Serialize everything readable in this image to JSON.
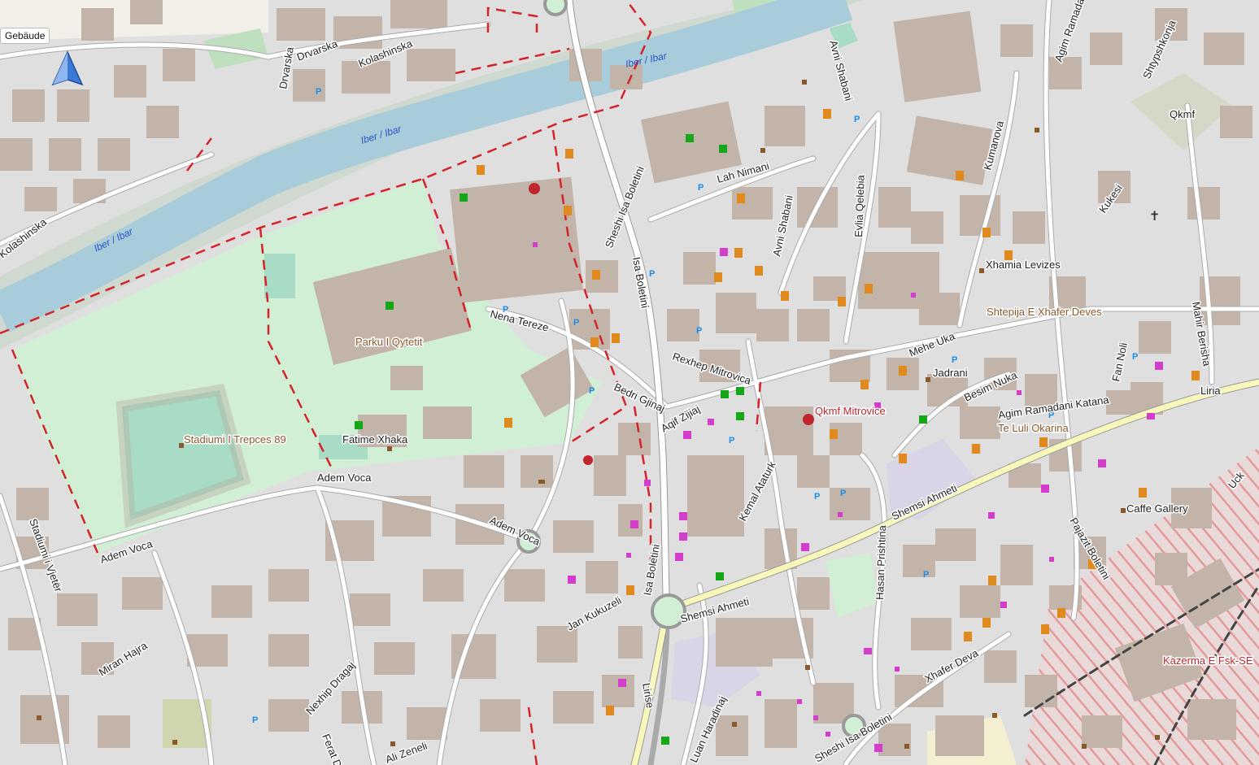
{
  "layer_label": "Gebäude",
  "colors": {
    "background": "#e0dfdf",
    "building": "#c3b4a9",
    "water": "#a9ccdb",
    "park": "#d1efd4",
    "pitch": "#a9dcc7",
    "road": "#ffffff",
    "primary_road": "#f8f8ba",
    "boundary": "#d4232a",
    "military": "#e49a9a"
  },
  "water_labels": [
    "Iber / Ibar",
    "Iber / Ibar",
    "Iber / Ibar"
  ],
  "street_labels": [
    "Kolashinska",
    "Drvarska",
    "Drvarska",
    "Kolashinska",
    "Nena Tereze",
    "Sheshi Isa Boletini",
    "Isa Boletini",
    "Lah Nimani",
    "Avni Shabani",
    "Avni Shabani",
    "Evlia Qelebia",
    "Kumanova",
    "Agim Ramadani",
    "Shtypshkonja",
    "Kukesi",
    "Rexhep Mitrovica",
    "Bedri Gjinaj",
    "Adem Voca",
    "Adem Voca",
    "Adem Voca",
    "Fatime Xhaka",
    "Mehe Uka",
    "Besim Nuka",
    "Agim Ramadani Katana",
    "Fan Noli",
    "Mahir Berisha",
    "Liria",
    "Shemsi Ahmeti",
    "Shemsi Ahmeti",
    "Kemal Ataturk",
    "Hasan Prishtina",
    "Stadiumi i Vjetër",
    "Miran Hajra",
    "Nexhip Dragaj",
    "Jan Kukuzeli",
    "Isa Boletini",
    "Ali Zeneli",
    "Luan Haradinaj",
    "Sheshi Isa Boletini",
    "Xhafer Deva",
    "Pajazit Boletini",
    "Uck",
    "Aqif Zijiaj",
    "Ferat Dr",
    "Lirise"
  ],
  "poi_labels": {
    "park": "Parku I Qytetit",
    "stadium": "Stadiumi I Trepces 89",
    "hospital": "Qkmf Mitrovice",
    "qkmf": "Qkmf",
    "mosque": "Xhamia Levizes",
    "house": "Shtepija E Xhafer Deves",
    "jadrani": "Jadrani",
    "teluli": "Te Luli Okarina",
    "caffe": "Caffe Gallery",
    "kazerma": "Kazerma E Fsk-SE"
  },
  "icons": [
    "navigation-compass-icon",
    "restaurant-icon",
    "cafe-icon",
    "hospital-icon",
    "pharmacy-icon",
    "parking-icon",
    "clothes-shop-icon",
    "supermarket-icon",
    "playground-icon",
    "worship-icon",
    "bank-icon",
    "hotel-icon"
  ]
}
